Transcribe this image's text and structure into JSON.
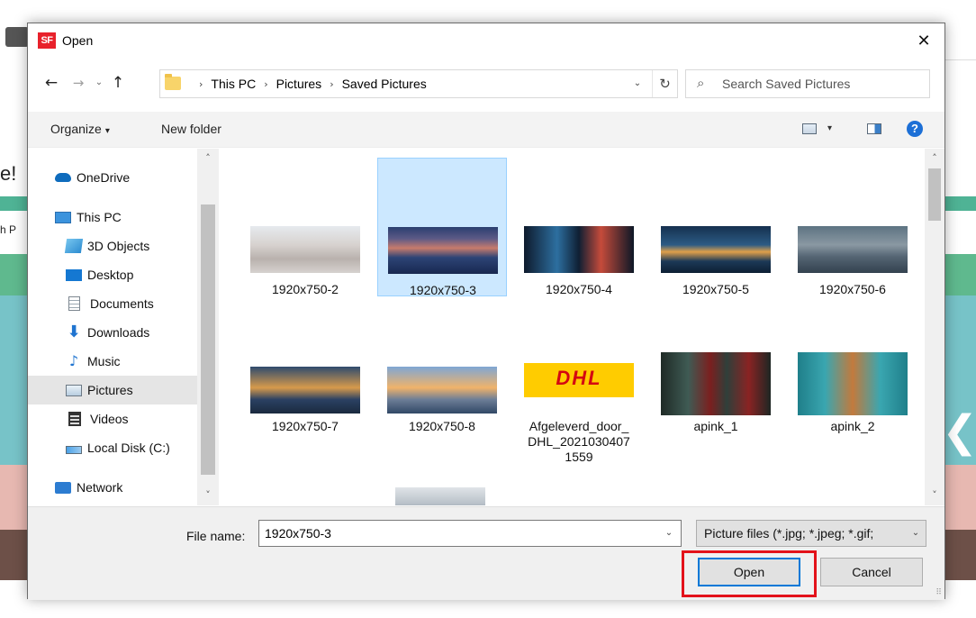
{
  "background": {
    "left_text_1": "e!",
    "left_text_2": "h P"
  },
  "dialog": {
    "app_icon_text": "SF",
    "title": "Open",
    "close_glyph": "✕"
  },
  "navigation": {
    "back_glyph": "←",
    "forward_glyph": "→",
    "recent_glyph": "⌄",
    "up_glyph": "↑",
    "breadcrumbs": [
      "This PC",
      "Pictures",
      "Saved Pictures"
    ],
    "crumb_separator": "›",
    "dropdown_glyph": "⌄",
    "refresh_glyph": "↻"
  },
  "search": {
    "placeholder": "Search Saved Pictures",
    "icon_glyph": "⌕"
  },
  "toolbar": {
    "organize_label": "Organize",
    "caret": "▾",
    "new_folder_label": "New folder",
    "help_label": "?"
  },
  "nav_pane": {
    "items": [
      {
        "label": "OneDrive",
        "icon": "onedrive-cloud-icon"
      },
      {
        "label": "This PC",
        "icon": "computer-icon"
      },
      {
        "label": "3D Objects",
        "icon": "3d-objects-icon"
      },
      {
        "label": "Desktop",
        "icon": "desktop-icon"
      },
      {
        "label": "Documents",
        "icon": "documents-icon"
      },
      {
        "label": "Downloads",
        "icon": "downloads-arrow-icon"
      },
      {
        "label": "Music",
        "icon": "music-note-icon"
      },
      {
        "label": "Pictures",
        "icon": "pictures-icon"
      },
      {
        "label": "Videos",
        "icon": "videos-icon"
      },
      {
        "label": "Local Disk (C:)",
        "icon": "local-disk-icon"
      },
      {
        "label": "Network",
        "icon": "network-icon"
      }
    ],
    "selected": "Pictures",
    "scroll_up": "˄",
    "scroll_down": "˅"
  },
  "files": {
    "items": [
      {
        "name": "1920x750-2"
      },
      {
        "name": "1920x750-3"
      },
      {
        "name": "1920x750-4"
      },
      {
        "name": "1920x750-5"
      },
      {
        "name": "1920x750-6"
      },
      {
        "name": "1920x750-7"
      },
      {
        "name": "1920x750-8"
      },
      {
        "name": "Afgeleverd_door_DHL_20210304071559",
        "lines": [
          "Afgeleverd_door_",
          "DHL_2021030407",
          "1559"
        ]
      },
      {
        "name": "apink_1"
      },
      {
        "name": "apink_2"
      }
    ],
    "selected": "1920x750-3",
    "dhl_logo_text": "DHL",
    "scroll_up": "˄",
    "scroll_down": "˅"
  },
  "bottom": {
    "file_name_label": "File name:",
    "file_name_value": "1920x750-3",
    "file_type": "Picture files (*.jpg; *.jpeg; *.gif;",
    "dropdown_glyph": "⌄",
    "open_label": "Open",
    "cancel_label": "Cancel",
    "grip": "⠿"
  },
  "colors": {
    "selection_bg": "#cce8ff",
    "selection_border": "#99d1ff",
    "accent": "#0078d7",
    "highlight_box": "#e3121b",
    "dhl_yellow": "#ffcc00",
    "dhl_red": "#d40511"
  }
}
